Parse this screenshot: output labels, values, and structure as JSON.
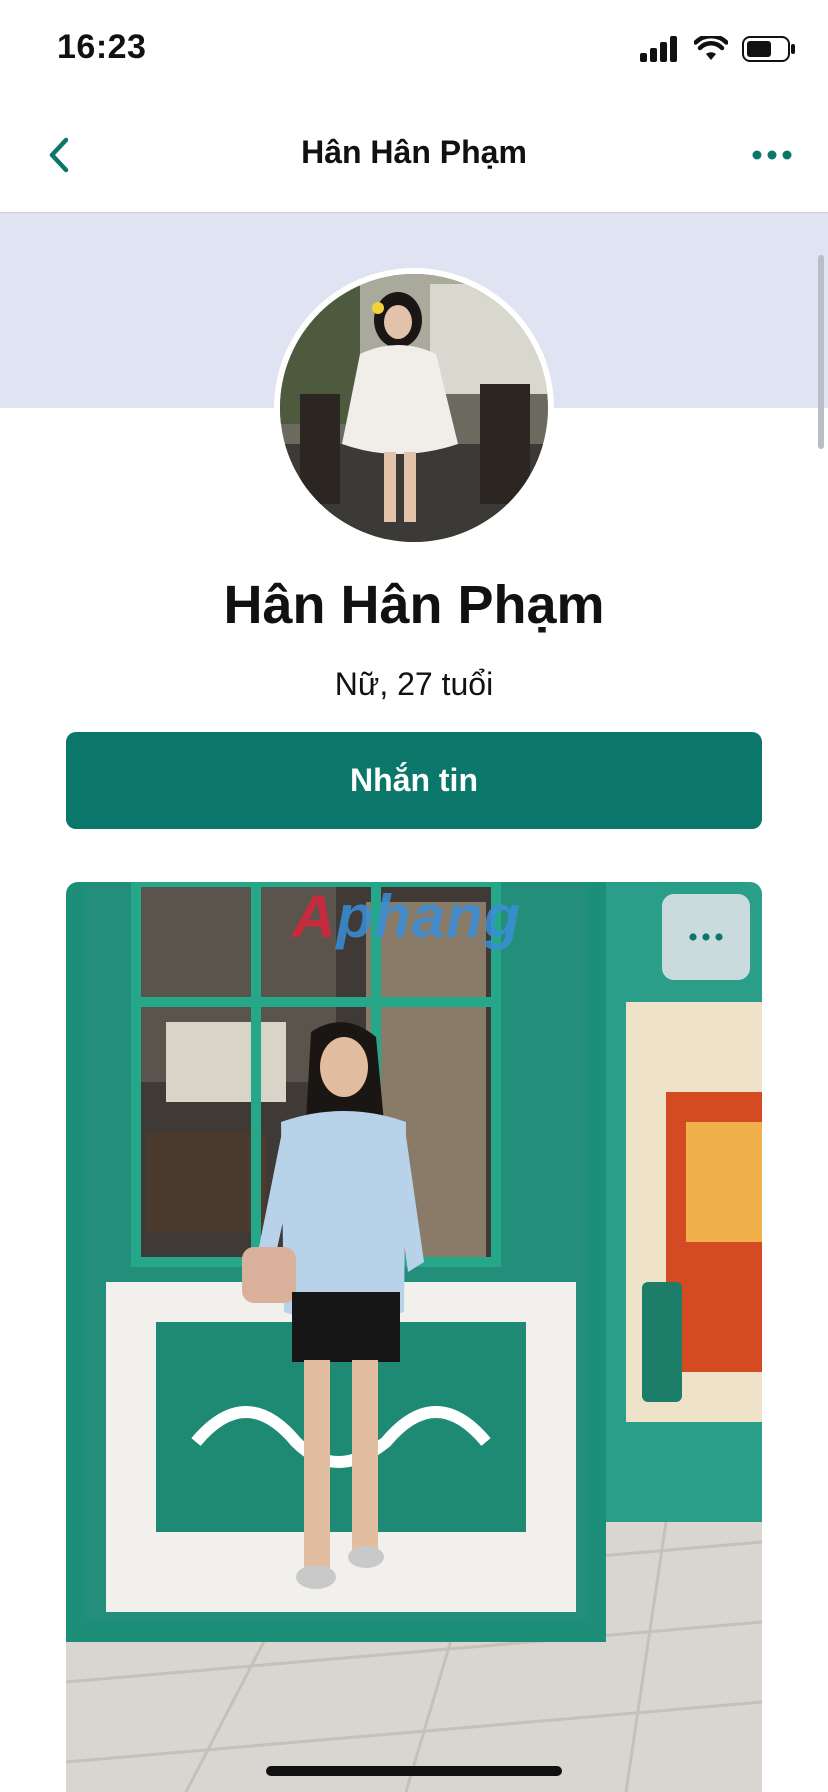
{
  "status_bar": {
    "time": "16:23"
  },
  "nav": {
    "title": "Hân Hân Phạm",
    "back_icon": "chevron-left-icon",
    "more_icon": "more-horizontal-icon"
  },
  "profile": {
    "name": "Hân Hân Phạm",
    "subtitle": "Nữ, 27 tuổi",
    "message_button": "Nhắn tin"
  },
  "photo": {
    "watermark": "Aphang",
    "more_icon": "more-horizontal-icon"
  },
  "colors": {
    "accent": "#0b766a",
    "cover": "#dfe3f2"
  }
}
